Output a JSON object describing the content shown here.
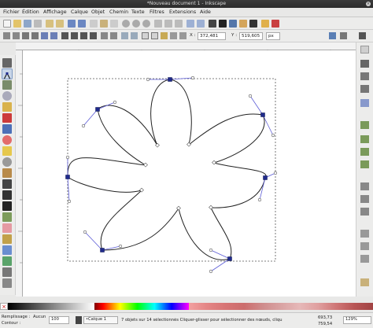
{
  "window": {
    "title": "*Nouveau document 1 - Inkscape"
  },
  "menubar": {
    "items": [
      "Fichier",
      "Édition",
      "Affichage",
      "Calque",
      "Objet",
      "Chemin",
      "Texte",
      "Filtres",
      "Extensions",
      "Aide"
    ]
  },
  "toolcontrols": {
    "x_label": "X :",
    "x_value": "372,481",
    "y_label": "Y :",
    "y_value": "519,605",
    "unit": "px"
  },
  "statusbar": {
    "fill_label": "Remplissage :",
    "fill_value": "Aucun",
    "stroke_label": "Contour :",
    "opacity_value": "100",
    "layer_label": "•Calque 1",
    "message": "7 objets sur 14 sélectionnés Cliquer-glisser pour sélectionner des nœuds, cliqu",
    "coord_x": "693,73",
    "coord_y": "759,54",
    "zoom": "129%"
  },
  "colors": {
    "node_fill": "#1f2a8c",
    "handle_line": "#5b5bd6",
    "selection_box": "#555555",
    "accent": "#7f9bc4"
  },
  "icons": {
    "toolbox": [
      "selector-tool-icon",
      "node-tool-icon",
      "tweak-tool-icon",
      "zoom-tool-icon",
      "measure-tool-icon",
      "rectangle-tool-icon",
      "box3d-tool-icon",
      "ellipse-tool-icon",
      "star-tool-icon",
      "spiral-tool-icon",
      "pencil-tool-icon",
      "pen-tool-icon",
      "calligraphy-tool-icon",
      "text-tool-icon",
      "spray-tool-icon",
      "eraser-tool-icon",
      "paint-bucket-tool-icon",
      "gradient-tool-icon",
      "mesh-tool-icon",
      "dropper-tool-icon",
      "connector-tool-icon"
    ]
  }
}
